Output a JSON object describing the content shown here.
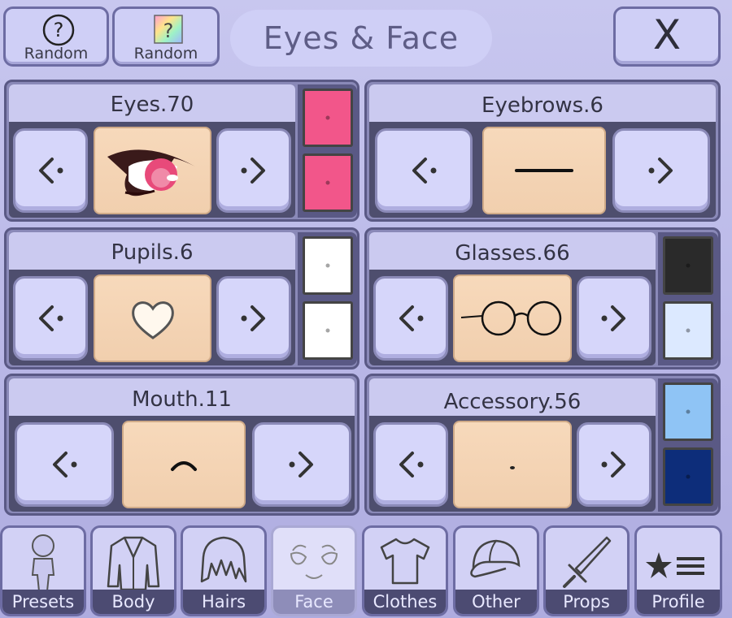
{
  "header": {
    "random1_label": "Random",
    "random2_label": "Random",
    "title": "Eyes & Face",
    "close_label": "X"
  },
  "panels": {
    "eyes": {
      "label": "Eyes.70",
      "colors": [
        "#f2568a",
        "#f2568a"
      ]
    },
    "eyebrows": {
      "label": "Eyebrows.6"
    },
    "pupils": {
      "label": "Pupils.6",
      "colors": [
        "#ffffff",
        "#ffffff"
      ]
    },
    "glasses": {
      "label": "Glasses.66",
      "colors": [
        "#2a2a2a",
        "#dce9ff"
      ]
    },
    "mouth": {
      "label": "Mouth.11"
    },
    "accessory": {
      "label": "Accessory.56",
      "colors": [
        "#8fc4f5",
        "#0d2d7a"
      ]
    }
  },
  "tabs": [
    {
      "label": "Presets",
      "icon": "person-icon"
    },
    {
      "label": "Body",
      "icon": "jacket-icon"
    },
    {
      "label": "Hairs",
      "icon": "hair-icon"
    },
    {
      "label": "Face",
      "icon": "face-icon",
      "active": true
    },
    {
      "label": "Clothes",
      "icon": "shirt-icon"
    },
    {
      "label": "Other",
      "icon": "cap-icon"
    },
    {
      "label": "Props",
      "icon": "sword-icon"
    },
    {
      "label": "Profile",
      "icon": "star-list-icon"
    }
  ]
}
